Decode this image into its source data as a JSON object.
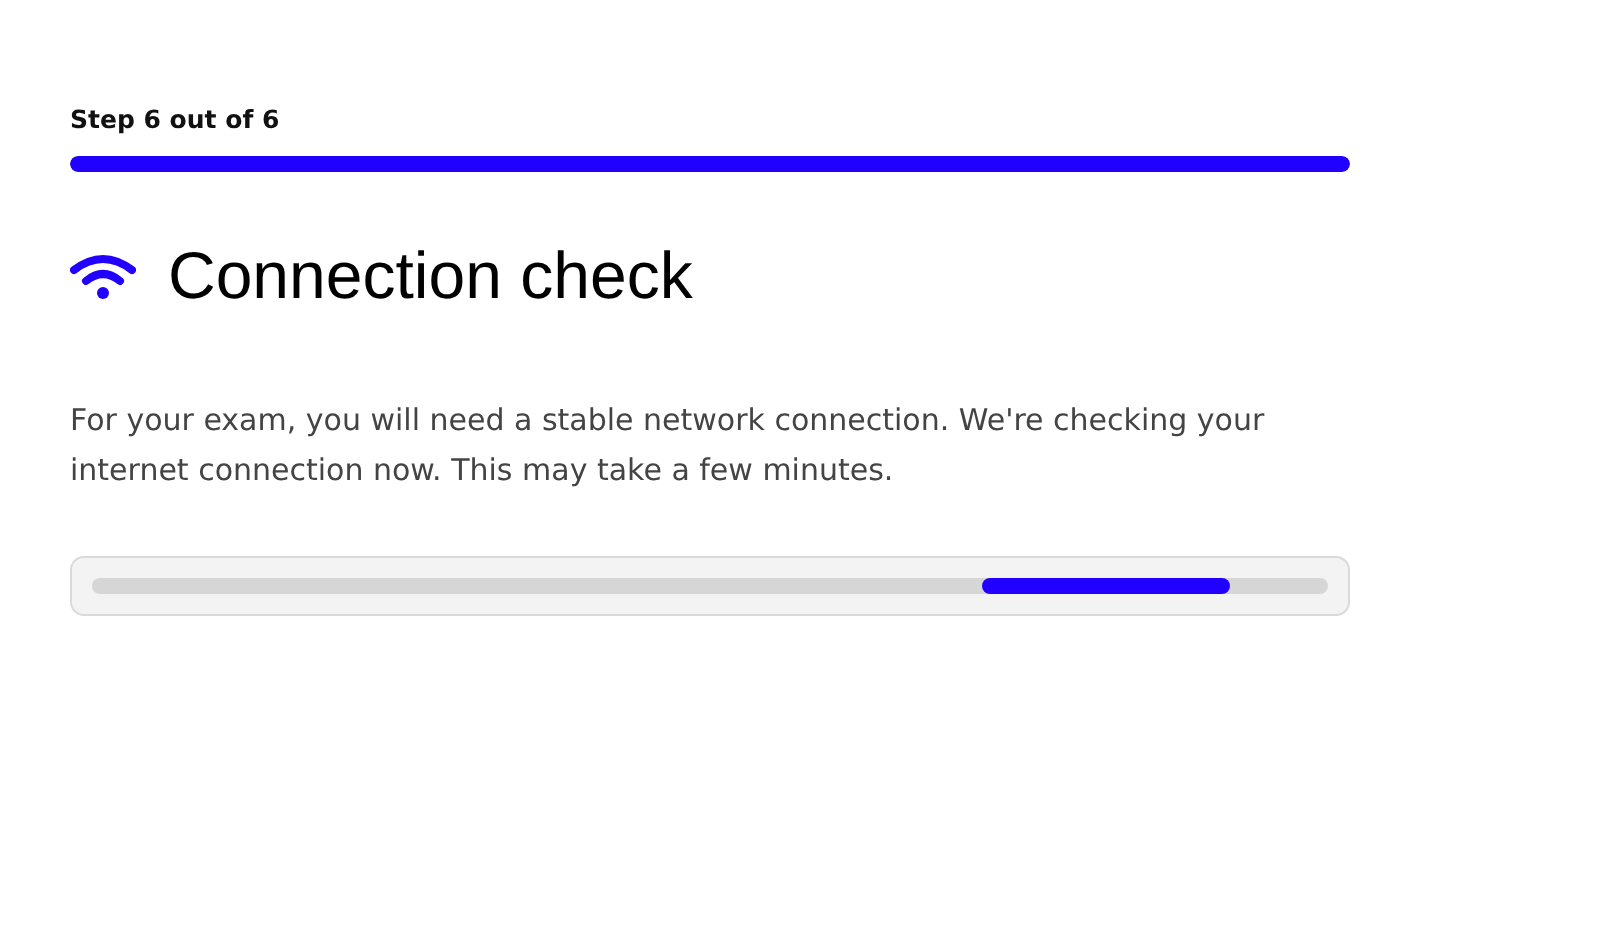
{
  "step": {
    "label": "Step 6 out of 6",
    "level": 1
  },
  "heading": {
    "title": "Connection check"
  },
  "description": "For your exam, you will need a stable network connection. We're checking your internet connection now. This may take a few minutes.",
  "loader": {
    "kind": "indeterminate"
  }
}
